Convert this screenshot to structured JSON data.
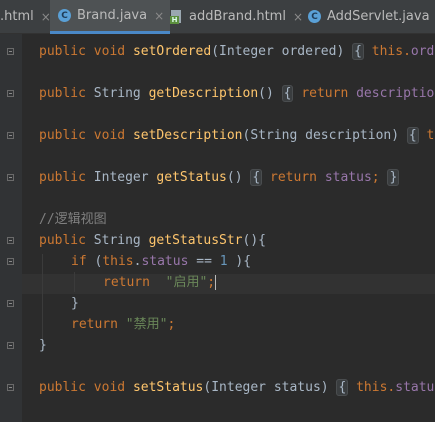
{
  "tabs": [
    {
      "label": ".html",
      "close": "×",
      "active": false,
      "icon": "html-file-icon"
    },
    {
      "label": "Brand.java",
      "close": "×",
      "active": true,
      "icon": "java-class-icon",
      "icon_letter": "C"
    },
    {
      "label": "addBrand.html",
      "close": "×",
      "active": false,
      "icon": "html-file-icon",
      "icon_letter": "H"
    },
    {
      "label": "AddServlet.java",
      "close": "×",
      "active": false,
      "icon": "java-class-icon",
      "icon_letter": "C"
    }
  ],
  "code": {
    "l1": {
      "k1": "public",
      "k2": "void",
      "fn": "setOrdered",
      "p1": "(Integer ordered)",
      "b1": "{",
      "k3": "this.",
      "fld": "ord"
    },
    "l2": {
      "k1": "public",
      "t": "String",
      "fn": "getDescription",
      "p1": "()",
      "b1": "{",
      "k3": "return",
      "fld": "descriptio"
    },
    "l3": {
      "k1": "public",
      "k2": "void",
      "fn": "setDescription",
      "p1": "(String description)",
      "b1": "{",
      "k3": "t"
    },
    "l4": {
      "k1": "public",
      "t": "Integer",
      "fn": "getStatus",
      "p1": "()",
      "b1": "{",
      "k3": "return",
      "fld": "status",
      "semi": ";",
      "b2": "}"
    },
    "l5": {
      "comment": "//逻辑视图"
    },
    "l6": {
      "k1": "public",
      "t": "String",
      "fn": "getStatusStr",
      "p1": "(){"
    },
    "l7": {
      "k1": "if",
      "p1": "(",
      "k2": "this",
      "dot": ".",
      "fld": "status",
      "op": " == ",
      "num": "1",
      "p2": " ){"
    },
    "l8": {
      "k1": "return",
      "str": "\"启用\"",
      "semi": ";"
    },
    "l9": {
      "b": "}"
    },
    "l10": {
      "k1": "return",
      "str": "\"禁用\"",
      "semi": ";"
    },
    "l11": {
      "b": "}"
    },
    "l12": {
      "k1": "public",
      "k2": "void",
      "fn": "setStatus",
      "p1": "(Integer status)",
      "b1": "{",
      "k3": "this.",
      "fld": "statu"
    }
  },
  "colors": {
    "background": "#2b2b2b",
    "keyword": "#cc7832",
    "method": "#ffc66d",
    "field": "#9876aa",
    "number": "#6897bb",
    "string": "#6a8759",
    "comment": "#808080",
    "tab_underline": "#4a88c7"
  }
}
